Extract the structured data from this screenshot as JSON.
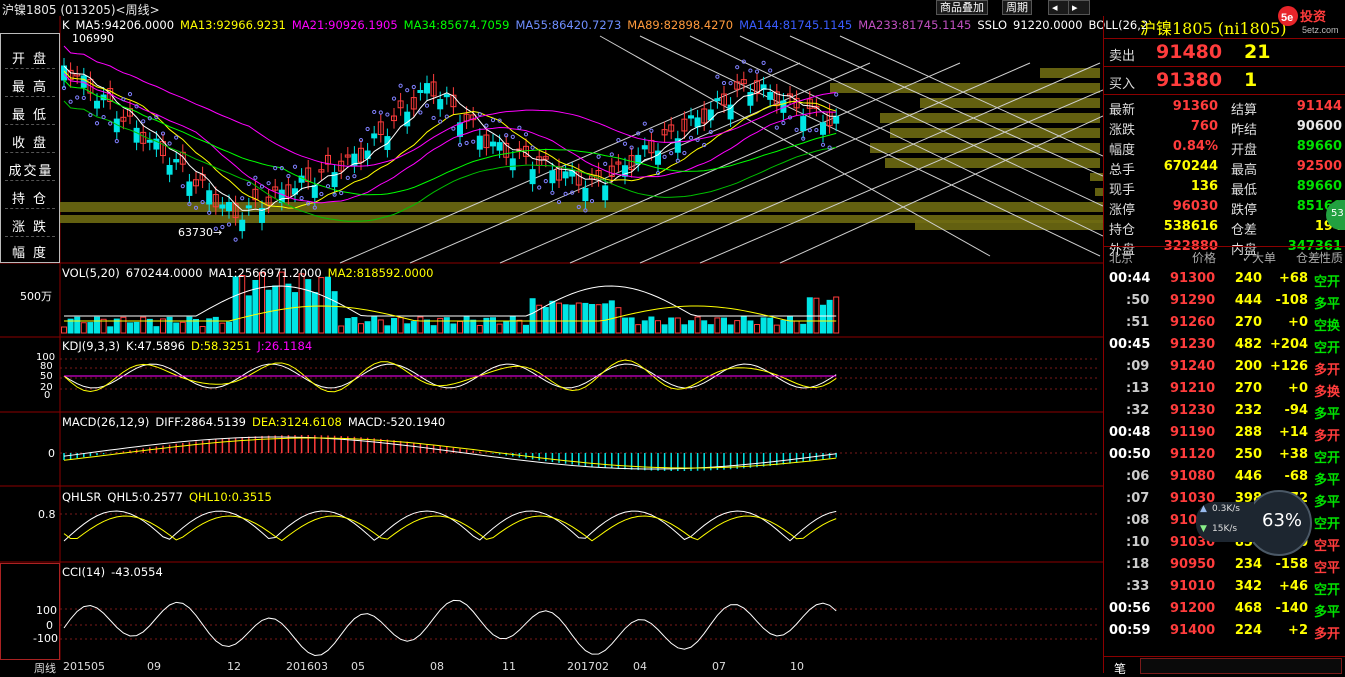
{
  "window": {
    "title": "沪镍1805 (013205)<周线>",
    "toolbar": [
      "商品叠加",
      "周期"
    ]
  },
  "kline": {
    "legend": [
      {
        "text": "K",
        "color": "#ffffff"
      },
      {
        "text": "MA5:94206.0000",
        "color": "#ffffff"
      },
      {
        "text": "MA13:92966.9231",
        "color": "#ffff00"
      },
      {
        "text": "MA21:90926.1905",
        "color": "#ff00ff"
      },
      {
        "text": "MA34:85674.7059",
        "color": "#00ff00"
      },
      {
        "text": "MA55:86420.7273",
        "color": "#6f8fff"
      },
      {
        "text": "MA89:82898.4270",
        "color": "#ff9a3c"
      },
      {
        "text": "MA144:81745.1145",
        "color": "#3a5cff"
      },
      {
        "text": "MA233:81745.1145",
        "color": "#c050c0"
      },
      {
        "text": "SSLO",
        "color": "#ffffff"
      },
      {
        "text": "91220.0000",
        "color": "#ffffff"
      },
      {
        "text": "BOLL(26,2",
        "color": "#ffffff"
      }
    ],
    "high_marker": "106990",
    "low_marker": "63730→"
  },
  "left_panel": {
    "items": [
      "开盘",
      "最高",
      "最低",
      "收盘",
      "成交量",
      "持仓",
      "涨跌",
      "幅度"
    ]
  },
  "volume": {
    "legend": [
      {
        "text": "VOL(5,20)",
        "color": "#ffffff"
      },
      {
        "text": "670244.0000",
        "color": "#ffffff"
      },
      {
        "text": "MA1:2566971.2000",
        "color": "#ffffff"
      },
      {
        "text": "MA2:818592.0000",
        "color": "#ffff00"
      }
    ],
    "axis_label": "500万"
  },
  "kdj": {
    "legend": [
      {
        "text": "KDJ(9,3,3)",
        "color": "#ffffff"
      },
      {
        "text": "K:47.5896",
        "color": "#ffffff"
      },
      {
        "text": "D:58.3251",
        "color": "#ffff00"
      },
      {
        "text": "J:26.1184",
        "color": "#ff00ff"
      }
    ],
    "ticks": [
      "100",
      "80",
      "50",
      "20",
      "0"
    ]
  },
  "macd": {
    "legend": [
      {
        "text": "MACD(26,12,9)",
        "color": "#ffffff"
      },
      {
        "text": "DIFF:2864.5139",
        "color": "#ffffff"
      },
      {
        "text": "DEA:3124.6108",
        "color": "#ffff00"
      },
      {
        "text": "MACD:-520.1940",
        "color": "#ffffff"
      }
    ],
    "tick": "0"
  },
  "qhlsr": {
    "legend": [
      {
        "text": "QHLSR",
        "color": "#ffffff"
      },
      {
        "text": "QHL5:0.2577",
        "color": "#ffffff"
      },
      {
        "text": "QHL10:0.3515",
        "color": "#ffff00"
      }
    ],
    "tick": "0.8"
  },
  "cci": {
    "legend": [
      {
        "text": "CCI(14)",
        "color": "#ffffff"
      },
      {
        "text": "-43.0554",
        "color": "#ffffff"
      }
    ],
    "ticks": [
      "100",
      "0",
      "-100"
    ]
  },
  "xaxis": {
    "period": "周线",
    "labels": [
      "201505",
      "09",
      "12",
      "201603",
      "05",
      "08",
      "11",
      "201702",
      "04",
      "07",
      "10"
    ]
  },
  "quote": {
    "title": "沪镍1805 (ni1805)",
    "sell": {
      "label": "卖出",
      "price": "91480",
      "vol": "21"
    },
    "buy": {
      "label": "买入",
      "price": "91380",
      "vol": "1"
    },
    "rows": [
      {
        "l1": "最新",
        "v1": "91360",
        "c1": "red",
        "l2": "结算",
        "v2": "91144",
        "c2": "red"
      },
      {
        "l1": "涨跌",
        "v1": "760",
        "c1": "red",
        "l2": "昨结",
        "v2": "90600",
        "c2": "white"
      },
      {
        "l1": "幅度",
        "v1": "0.84%",
        "c1": "red",
        "l2": "开盘",
        "v2": "89660",
        "c2": "green"
      },
      {
        "l1": "总手",
        "v1": "670244",
        "c1": "yellow",
        "l2": "最高",
        "v2": "92500",
        "c2": "red"
      },
      {
        "l1": "现手",
        "v1": "136",
        "c1": "yellow",
        "l2": "最低",
        "v2": "89660",
        "c2": "green"
      },
      {
        "l1": "涨停",
        "v1": "96030",
        "c1": "red",
        "l2": "跌停",
        "v2": "85160",
        "c2": "green"
      },
      {
        "l1": "持仓",
        "v1": "538616",
        "c1": "yellow",
        "l2": "仓差",
        "v2": "194",
        "c2": "yellow"
      },
      {
        "l1": "外盘",
        "v1": "322880",
        "c1": "red",
        "l2": "内盘",
        "v2": "347361",
        "c2": "green"
      }
    ],
    "trades_header": [
      "北京",
      "价格",
      "✓大单",
      "仓差",
      "性质"
    ],
    "trades": [
      {
        "time": "00:44",
        "price": "91300",
        "vol": "240",
        "diff": "+68",
        "nature": "空开",
        "nc": "green"
      },
      {
        "time": ":50",
        "price": "91290",
        "vol": "444",
        "diff": "-108",
        "nature": "多平",
        "nc": "green"
      },
      {
        "time": ":51",
        "price": "91260",
        "vol": "270",
        "diff": "+0",
        "nature": "空换",
        "nc": "green"
      },
      {
        "time": "00:45",
        "price": "91230",
        "vol": "482",
        "diff": "+204",
        "nature": "空开",
        "nc": "green"
      },
      {
        "time": ":09",
        "price": "91240",
        "vol": "200",
        "diff": "+126",
        "nature": "多开",
        "nc": "red"
      },
      {
        "time": ":13",
        "price": "91210",
        "vol": "270",
        "diff": "+0",
        "nature": "多换",
        "nc": "red"
      },
      {
        "time": ":32",
        "price": "91230",
        "vol": "232",
        "diff": "-94",
        "nature": "多平",
        "nc": "green"
      },
      {
        "time": "00:48",
        "price": "91190",
        "vol": "288",
        "diff": "+14",
        "nature": "多开",
        "nc": "red"
      },
      {
        "time": "00:50",
        "price": "91120",
        "vol": "250",
        "diff": "+38",
        "nature": "空开",
        "nc": "green"
      },
      {
        "time": ":06",
        "price": "91080",
        "vol": "446",
        "diff": "-68",
        "nature": "多平",
        "nc": "green"
      },
      {
        "time": ":07",
        "price": "91030",
        "vol": "398",
        "diff": "-72",
        "nature": "多平",
        "nc": "green"
      },
      {
        "time": ":08",
        "price": "91010",
        "vol": "218",
        "diff": "+8",
        "nature": "空开",
        "nc": "green"
      },
      {
        "time": ":10",
        "price": "91030",
        "vol": "850",
        "diff": "-250",
        "nature": "空平",
        "nc": "red"
      },
      {
        "time": ":18",
        "price": "90950",
        "vol": "234",
        "diff": "-158",
        "nature": "空平",
        "nc": "red"
      },
      {
        "time": ":33",
        "price": "91010",
        "vol": "342",
        "diff": "+46",
        "nature": "空开",
        "nc": "green"
      },
      {
        "time": "00:56",
        "price": "91200",
        "vol": "468",
        "diff": "-140",
        "nature": "多平",
        "nc": "green"
      },
      {
        "time": "00:59",
        "price": "91400",
        "vol": "224",
        "diff": "+2",
        "nature": "多开",
        "nc": "red"
      }
    ],
    "footer": "笔"
  },
  "net_monitor": {
    "up": "0.3K/s",
    "down": "15K/s",
    "percent": "63%"
  },
  "badge": "53"
}
